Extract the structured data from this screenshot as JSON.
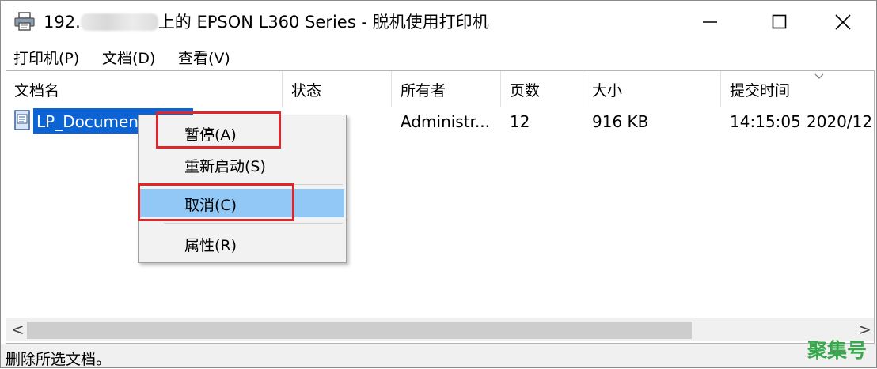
{
  "window": {
    "title_prefix": "192.",
    "title_suffix": "上的 EPSON L360 Series  -  脱机使用打印机"
  },
  "menubar": {
    "items": [
      {
        "label": "打印机(P)"
      },
      {
        "label": "文档(D)"
      },
      {
        "label": "查看(V)"
      }
    ]
  },
  "columns": [
    {
      "label": "文档名"
    },
    {
      "label": "状态"
    },
    {
      "label": "所有者"
    },
    {
      "label": "页数"
    },
    {
      "label": "大小"
    },
    {
      "label": "提交时间"
    }
  ],
  "job": {
    "name": "LP_Documen",
    "status": "",
    "owner": "Administr...",
    "pages": "12",
    "size": "916 KB",
    "time": "14:15:05",
    "date": "2020/12"
  },
  "context_menu": {
    "items": [
      {
        "label": "暂停(A)"
      },
      {
        "label": "重新启动(S)"
      },
      {
        "label": "取消(C)"
      },
      {
        "label": "属性(R)"
      }
    ]
  },
  "scrollbar": {
    "left_arrow": "<",
    "right_arrow": ">"
  },
  "statusbar": {
    "text": "删除所选文档。"
  },
  "watermark": {
    "text": "聚集号"
  },
  "colors": {
    "selection": "#0c63d4",
    "menu_highlight": "#91c8f5",
    "annotation_box": "#e0262a",
    "watermark": "#38a84c"
  }
}
